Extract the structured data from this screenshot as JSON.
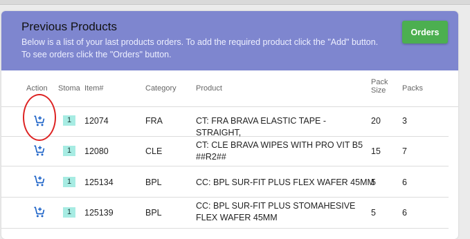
{
  "panel": {
    "title": "Previous Products",
    "description_line1": "Below is a list of your last products orders. To add the required product click the \"Add\" button.",
    "description_line2": "To see orders click the \"Orders\" button.",
    "orders_button": "Orders"
  },
  "table": {
    "headers": {
      "action": "Action",
      "stoma": "Stoma",
      "item": "Item#",
      "category": "Category",
      "product": "Product",
      "pack_size_1": "Pack",
      "pack_size_2": "Size",
      "packs": "Packs"
    },
    "rows": [
      {
        "stoma": "1",
        "item": "12074",
        "category": "FRA",
        "product": "CT: FRA BRAVA ELASTIC TAPE - STRAIGHT,",
        "pack_size": "20",
        "packs": "3"
      },
      {
        "stoma": "1",
        "item": "12080",
        "category": "CLE",
        "product": "CT: CLE BRAVA WIPES WITH PRO VIT B5 ##R2##",
        "pack_size": "15",
        "packs": "7"
      },
      {
        "stoma": "1",
        "item": "125134",
        "category": "BPL",
        "product": "CC: BPL SUR-FIT PLUS FLEX WAFER 45MM",
        "pack_size": "5",
        "packs": "6"
      },
      {
        "stoma": "1",
        "item": "125139",
        "category": "BPL",
        "product": "CC: BPL SUR-FIT PLUS STOMAHESIVE FLEX WAFER 45MM",
        "pack_size": "5",
        "packs": "6"
      }
    ]
  },
  "colors": {
    "header_bg": "#7e86cf",
    "orders_button": "#4caf50",
    "cart_icon": "#1e64c8",
    "stoma_badge": "#a7ece3",
    "highlight_circle": "#dd2222"
  },
  "icons": {
    "add": "add-to-cart-icon"
  }
}
